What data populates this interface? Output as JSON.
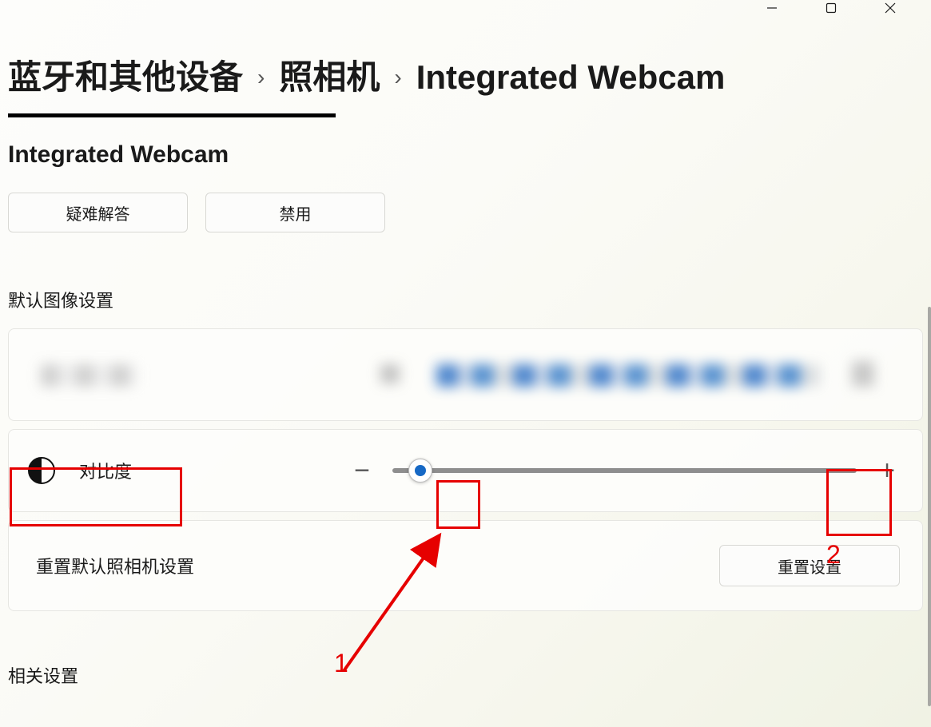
{
  "window": {
    "minimize": "—",
    "maximize": "▢",
    "close": "✕"
  },
  "breadcrumb": {
    "items": [
      "蓝牙和其他设备",
      "照相机",
      "Integrated Webcam"
    ],
    "separator": "›"
  },
  "header": {
    "title": "Integrated Webcam",
    "buttons": {
      "troubleshoot": "疑难解答",
      "disable": "禁用"
    }
  },
  "settings": {
    "group_label": "默认图像设置",
    "contrast": {
      "label": "对比度",
      "minus": "−",
      "plus": "+",
      "thumb_percent": 6
    },
    "reset": {
      "label": "重置默认照相机设置",
      "button": "重置设置"
    }
  },
  "related": {
    "label": "相关设置"
  },
  "annotations": {
    "marker1": "1",
    "marker2": "2"
  }
}
